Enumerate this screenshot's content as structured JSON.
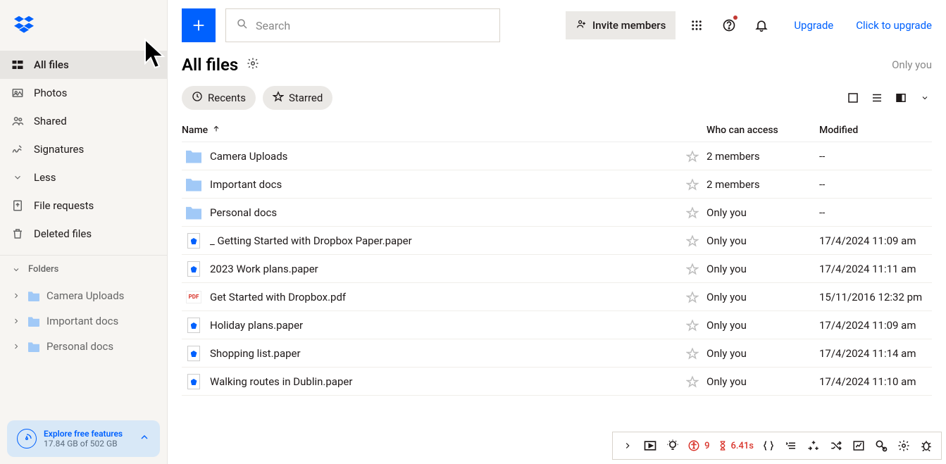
{
  "sidebar": {
    "nav": {
      "allfiles": "All files",
      "photos": "Photos",
      "shared": "Shared",
      "signatures": "Signatures",
      "less": "Less",
      "filerequests": "File requests",
      "deleted": "Deleted files"
    },
    "folders_header": "Folders",
    "folders": [
      {
        "label": "Camera Uploads"
      },
      {
        "label": "Important docs"
      },
      {
        "label": "Personal docs"
      }
    ],
    "promo": {
      "title": "Explore free features",
      "sub": "17.84 GB of 502 GB"
    }
  },
  "topbar": {
    "search_placeholder": "Search",
    "invite": "Invite members",
    "upgrade": "Upgrade",
    "click_upgrade": "Click to upgrade"
  },
  "title": {
    "heading": "All files",
    "scope": "Only you"
  },
  "chips": {
    "recents": "Recents",
    "starred": "Starred"
  },
  "table": {
    "headers": {
      "name": "Name",
      "access": "Who can access",
      "modified": "Modified"
    },
    "rows": [
      {
        "icon": "folder-shared",
        "name": "Camera Uploads",
        "access": "2 members",
        "modified": "--"
      },
      {
        "icon": "folder-shared",
        "name": "Important docs",
        "access": "2 members",
        "modified": "--"
      },
      {
        "icon": "folder",
        "name": "Personal docs",
        "access": "Only you",
        "modified": "--"
      },
      {
        "icon": "paper",
        "name": "_ Getting Started with Dropbox Paper.paper",
        "access": "Only you",
        "modified": "17/4/2024 11:09 am"
      },
      {
        "icon": "paper",
        "name": "2023 Work plans.paper",
        "access": "Only you",
        "modified": "17/4/2024 11:11 am"
      },
      {
        "icon": "pdf",
        "name": "Get Started with Dropbox.pdf",
        "access": "Only you",
        "modified": "15/11/2016 12:32 pm"
      },
      {
        "icon": "paper",
        "name": "Holiday plans.paper",
        "access": "Only you",
        "modified": "17/4/2024 11:09 am"
      },
      {
        "icon": "paper",
        "name": "Shopping list.paper",
        "access": "Only you",
        "modified": "17/4/2024 11:14 am"
      },
      {
        "icon": "paper",
        "name": "Walking routes in Dublin.paper",
        "access": "Only you",
        "modified": "17/4/2024 11:10 am"
      }
    ]
  },
  "debugbar": {
    "a11y_count": "9",
    "timer": "6.41s",
    "pdf_label": "PDF"
  }
}
